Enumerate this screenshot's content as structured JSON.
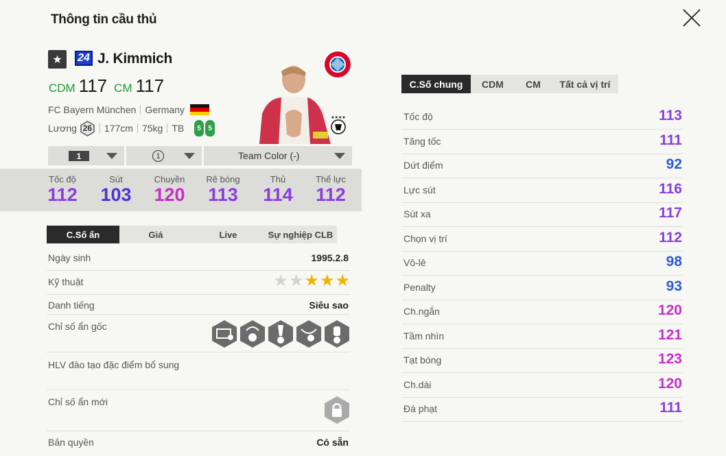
{
  "window": {
    "title": "Thông tin cầu thủ"
  },
  "player": {
    "season_num": "24",
    "name": "J. Kimmich",
    "positions": [
      {
        "code": "CDM",
        "ovr": "117"
      },
      {
        "code": "CM",
        "ovr": "117"
      }
    ],
    "club": "FC Bayern München",
    "nation": "Germany",
    "salary_label": "Lương",
    "salary": "26",
    "height": "177cm",
    "weight": "75kg",
    "body_type": "TB",
    "weak_foot_left": "5",
    "weak_foot_right": "5"
  },
  "selectors": {
    "level": "1",
    "grade": "1",
    "team_color": "Team Color (-)"
  },
  "summary_stats": [
    {
      "label": "Tốc độ",
      "value": "112",
      "color": "#8a3ce0"
    },
    {
      "label": "Sút",
      "value": "103",
      "color": "#4a34d6"
    },
    {
      "label": "Chuyền",
      "value": "120",
      "color": "#c42fc9"
    },
    {
      "label": "Rê bóng",
      "value": "113",
      "color": "#8a3ce0"
    },
    {
      "label": "Thủ",
      "value": "114",
      "color": "#8a3ce0"
    },
    {
      "label": "Thể lực",
      "value": "112",
      "color": "#8a3ce0"
    }
  ],
  "left_tabs": [
    "C.Số ẩn",
    "Giá",
    "Live",
    "Sự nghiệp CLB"
  ],
  "details": {
    "birth_label": "Ngày sinh",
    "birth_value": "1995.2.8",
    "skill_label": "Kỹ thuật",
    "skill_stars": 3,
    "skill_max": 5,
    "rep_label": "Danh tiếng",
    "rep_value": "Siêu sao",
    "traits_label": "Chỉ số ẩn gốc",
    "traits_icons": [
      "long-shot-trait-icon",
      "flair-pass-trait-icon",
      "playmaker-trait-icon",
      "outside-foot-trait-icon",
      "power-header-trait-icon"
    ],
    "coach_label": "HLV đào tạo đặc điểm bổ sung",
    "new_traits_label": "Chỉ số ẩn mới",
    "license_label": "Bản quyền",
    "license_value": "Có sẵn"
  },
  "right_tabs": [
    "C.Số chung",
    "CDM",
    "CM",
    "Tất cả vị trí"
  ],
  "attributes": [
    {
      "label": "Tốc độ",
      "value": "113",
      "color": "#8a3ce0"
    },
    {
      "label": "Tăng tốc",
      "value": "111",
      "color": "#8a3ce0"
    },
    {
      "label": "Dứt điểm",
      "value": "92",
      "color": "#2d5bd6"
    },
    {
      "label": "Lực sút",
      "value": "116",
      "color": "#8a3ce0"
    },
    {
      "label": "Sút xa",
      "value": "117",
      "color": "#8a3ce0"
    },
    {
      "label": "Chọn vị trí",
      "value": "112",
      "color": "#8a3ce0"
    },
    {
      "label": "Vô-lê",
      "value": "98",
      "color": "#2d5bd6"
    },
    {
      "label": "Penalty",
      "value": "93",
      "color": "#2d5bd6"
    },
    {
      "label": "Ch.ngắn",
      "value": "120",
      "color": "#c42fc9"
    },
    {
      "label": "Tầm nhìn",
      "value": "121",
      "color": "#c42fc9"
    },
    {
      "label": "Tạt bóng",
      "value": "123",
      "color": "#c42fc9"
    },
    {
      "label": "Ch.dài",
      "value": "120",
      "color": "#c42fc9"
    },
    {
      "label": "Đá phạt",
      "value": "111",
      "color": "#8a3ce0"
    }
  ]
}
